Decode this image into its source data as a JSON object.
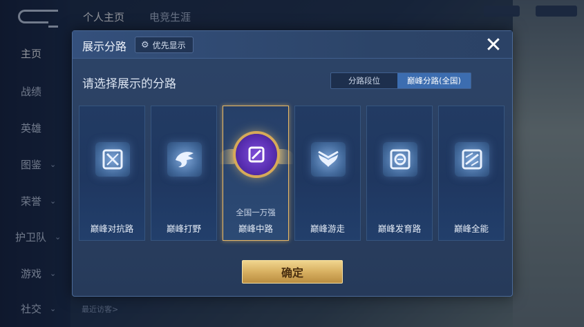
{
  "background": {
    "nav": [
      {
        "label": "主页",
        "active": true,
        "chevron": false
      },
      {
        "label": "战绩",
        "chevron": false
      },
      {
        "label": "英雄",
        "chevron": false
      },
      {
        "label": "图鉴",
        "chevron": true
      },
      {
        "label": "荣誉",
        "chevron": true
      },
      {
        "label": "护卫队",
        "chevron": true
      },
      {
        "label": "游戏",
        "chevron": true
      },
      {
        "label": "社交",
        "chevron": true
      }
    ],
    "top_tabs": [
      "个人主页",
      "电竞生涯"
    ],
    "recent_visitors": "最近访客>"
  },
  "modal": {
    "title": "展示分路",
    "priority_button": "优先显示",
    "subtitle": "请选择展示的分路",
    "segments": [
      {
        "label": "分路段位",
        "selected": false
      },
      {
        "label": "巅峰分路(全国)",
        "selected": true
      }
    ],
    "cards": [
      {
        "label": "巅峰对抗路",
        "icon": "crossed-swords-icon",
        "selected": false
      },
      {
        "label": "巅峰打野",
        "icon": "dragon-head-icon",
        "selected": false
      },
      {
        "label": "巅峰中路",
        "icon": "mid-lane-icon",
        "selected": true,
        "rank": "全国一万强"
      },
      {
        "label": "巅峰游走",
        "icon": "wings-icon",
        "selected": false
      },
      {
        "label": "巅峰发育路",
        "icon": "target-icon",
        "selected": false
      },
      {
        "label": "巅峰全能",
        "icon": "all-round-icon",
        "selected": false
      }
    ],
    "confirm": "确定"
  },
  "colors": {
    "selected_border": "#e8b865",
    "segment_active": "#3c6db0",
    "confirm_gold": "#d8b061"
  }
}
